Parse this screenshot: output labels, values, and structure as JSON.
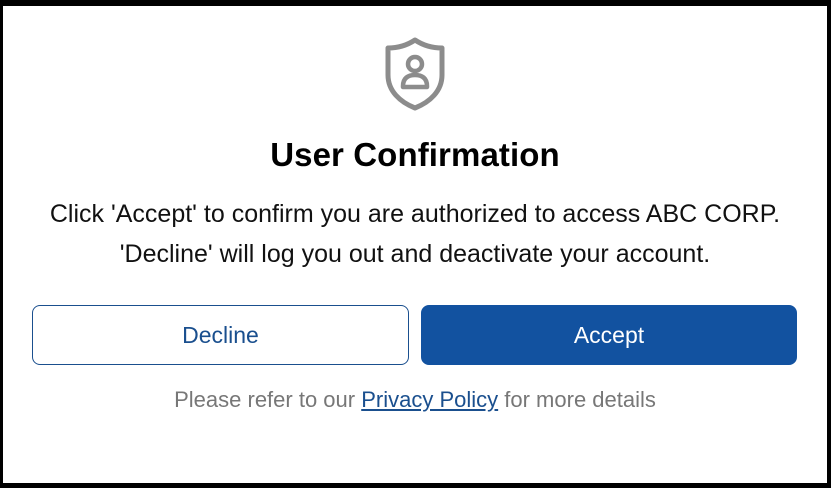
{
  "dialog": {
    "icon": "user-shield-icon",
    "title": "User Confirmation",
    "message": "Click 'Accept' to confirm you are authorized to access ABC CORP. 'Decline' will log you out and deactivate your account.",
    "decline_label": "Decline",
    "accept_label": "Accept",
    "footer_prefix": "Please refer to our",
    "footer_link": "Privacy Policy",
    "footer_suffix": "for more details"
  },
  "colors": {
    "accent": "#1252a0",
    "icon_gray": "#8c8c8c",
    "footer_text": "#777777"
  }
}
